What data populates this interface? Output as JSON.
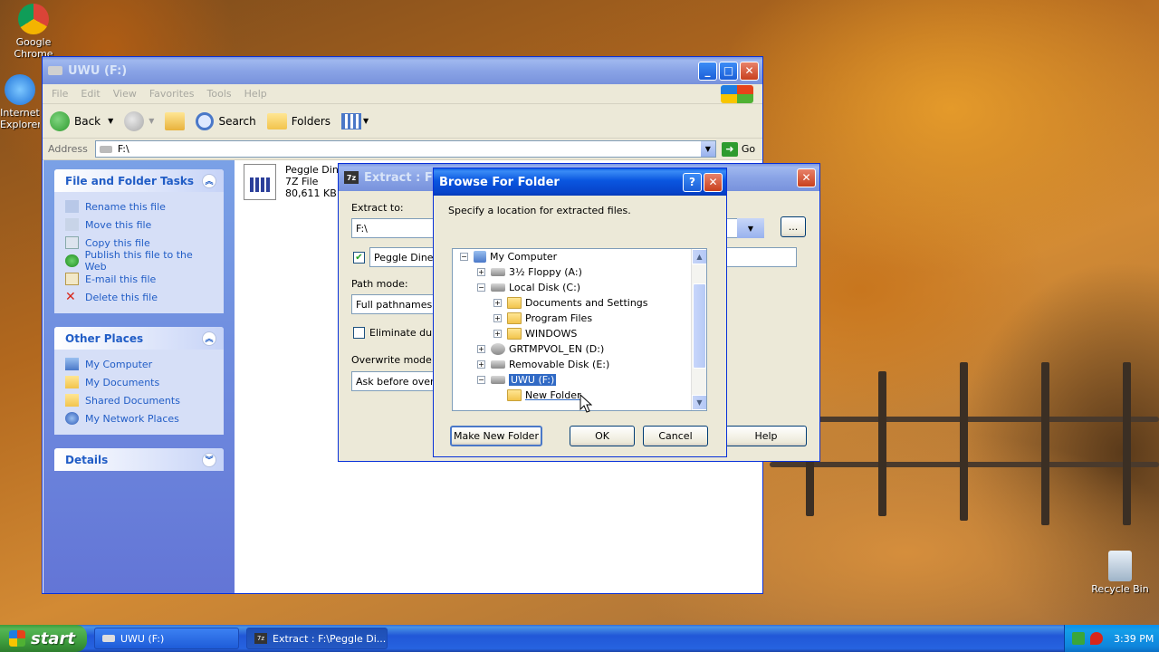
{
  "desktop": {
    "icons": [
      {
        "label": "Google Chrome"
      },
      {
        "label": "Internet Explorer"
      },
      {
        "label": "Recycle Bin"
      }
    ]
  },
  "explorer": {
    "title": "UWU (F:)",
    "menu": [
      "File",
      "Edit",
      "View",
      "Favorites",
      "Tools",
      "Help"
    ],
    "toolbar": {
      "back": "Back",
      "search": "Search",
      "folders": "Folders"
    },
    "address": {
      "label": "Address",
      "value": "F:\\",
      "go": "Go"
    },
    "tasks_panel": {
      "title": "File and Folder Tasks",
      "items": [
        "Rename this file",
        "Move this file",
        "Copy this file",
        "Publish this file to the Web",
        "E-mail this file",
        "Delete this file"
      ]
    },
    "places_panel": {
      "title": "Other Places",
      "items": [
        "My Computer",
        "My Documents",
        "Shared Documents",
        "My Network Places"
      ]
    },
    "details_panel": {
      "title": "Details"
    },
    "file": {
      "name": "Peggle Dine",
      "type": "7Z File",
      "size": "80,611 KB"
    }
  },
  "extract": {
    "title": "Extract : F:\\",
    "extract_to_label": "Extract to:",
    "extract_to_value": "F:\\",
    "browse_btn": "...",
    "subfolder_value": "Peggle Dinee",
    "path_mode_label": "Path mode:",
    "path_mode_value": "Full pathnames",
    "eliminate_label": "Eliminate duplic",
    "overwrite_label": "Overwrite mode:",
    "overwrite_value": "Ask before overw",
    "help_btn": "Help"
  },
  "browse": {
    "title": "Browse For Folder",
    "instruction": "Specify a location for extracted files.",
    "tree": [
      {
        "label": "My Computer",
        "toggle": "−"
      },
      {
        "label": "3½ Floppy (A:)",
        "toggle": "+"
      },
      {
        "label": "Local Disk (C:)",
        "toggle": "−"
      },
      {
        "label": "Documents and Settings",
        "toggle": "+"
      },
      {
        "label": "Program Files",
        "toggle": "+"
      },
      {
        "label": "WINDOWS",
        "toggle": "+"
      },
      {
        "label": "GRTMPVOL_EN (D:)",
        "toggle": "+"
      },
      {
        "label": "Removable Disk (E:)",
        "toggle": "+"
      },
      {
        "label": "UWU (F:)",
        "toggle": "−"
      },
      {
        "label": "New Folder",
        "toggle": ""
      }
    ],
    "make_new_folder": "Make New Folder",
    "ok": "OK",
    "cancel": "Cancel"
  },
  "taskbar": {
    "start": "start",
    "tasks": [
      "UWU (F:)",
      "Extract : F:\\Peggle Di..."
    ],
    "clock": "3:39 PM"
  },
  "colors": {
    "xp_blue": "#0a56e0",
    "task_link": "#215dc6",
    "selection": "#316ac5",
    "start_green": "#3e9e3e"
  }
}
